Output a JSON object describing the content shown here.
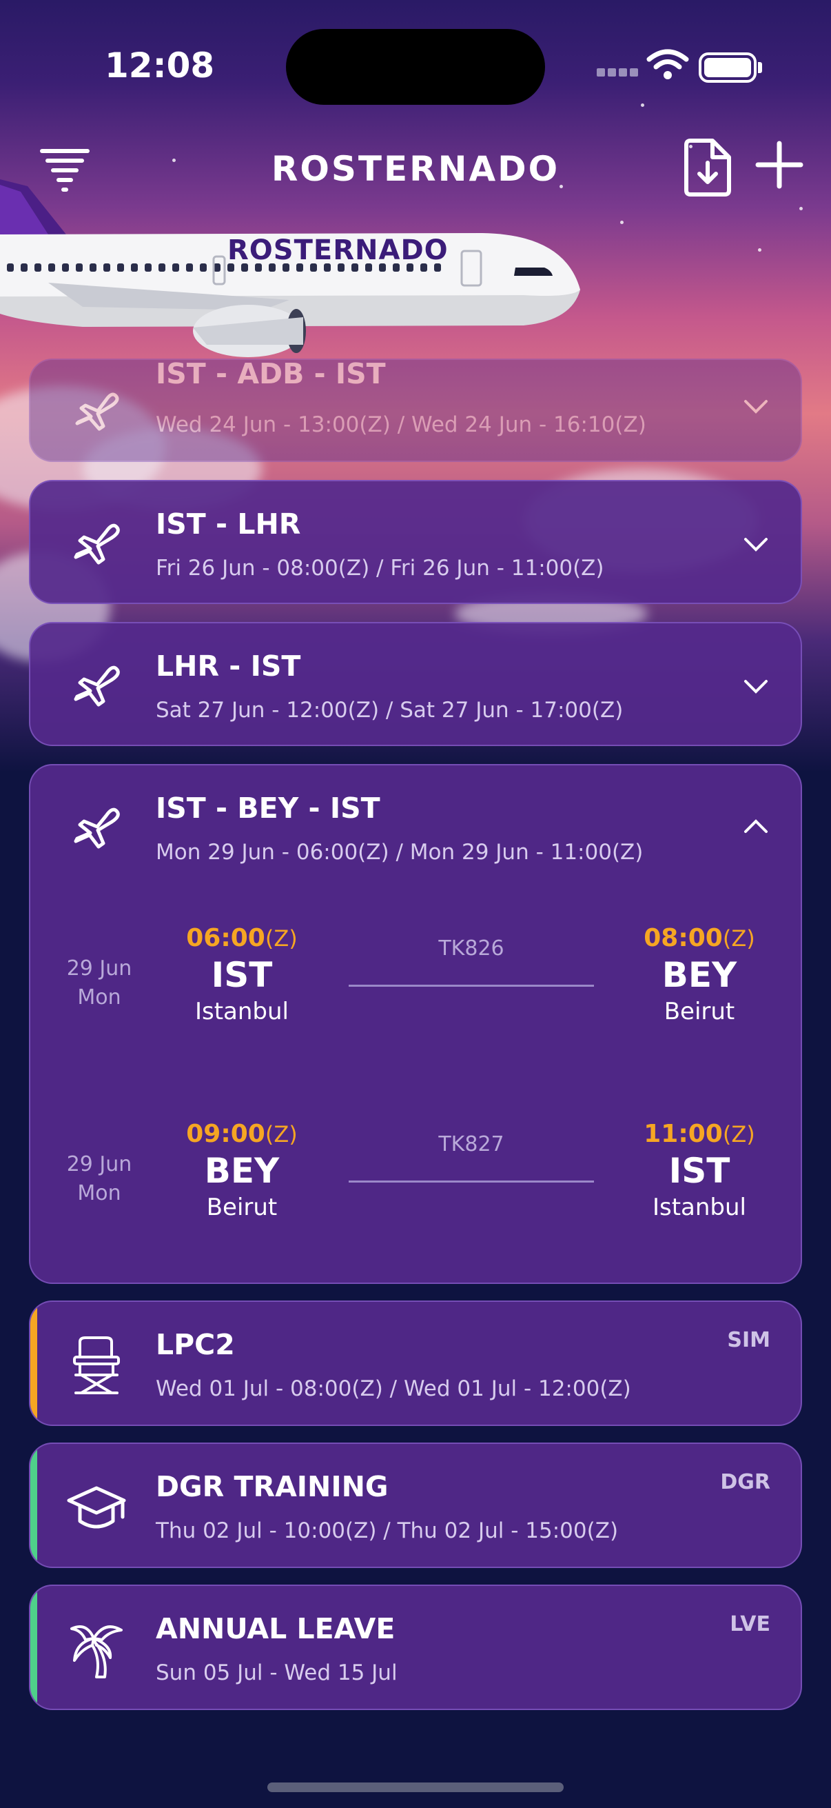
{
  "status_bar": {
    "time": "12:08"
  },
  "header": {
    "title": "ROSTERNADO"
  },
  "plane": {
    "brand": "ROSTERNADO"
  },
  "duties": [
    {
      "title": "IST - ADB - IST",
      "subtitle": "Wed 24 Jun - 13:00(Z) / Wed 24 Jun - 16:10(Z)",
      "icon": "plane-icon",
      "expanded": false
    },
    {
      "title": "IST - LHR",
      "subtitle": "Fri 26 Jun - 08:00(Z) / Fri 26 Jun - 11:00(Z)",
      "icon": "plane-icon",
      "expanded": false
    },
    {
      "title": "LHR - IST",
      "subtitle": "Sat 27 Jun - 12:00(Z) / Sat 27 Jun - 17:00(Z)",
      "icon": "plane-icon",
      "expanded": false
    },
    {
      "title": "IST - BEY - IST",
      "subtitle": "Mon 29 Jun - 06:00(Z) / Mon 29 Jun - 11:00(Z)",
      "icon": "plane-icon",
      "expanded": true,
      "legs": [
        {
          "date_day": "29 Jun",
          "date_weekday": "Mon",
          "dep_time": "06:00",
          "dep_zone": "(Z)",
          "dep_iata": "IST",
          "dep_city": "Istanbul",
          "flight": "TK826",
          "arr_time": "08:00",
          "arr_zone": "(Z)",
          "arr_iata": "BEY",
          "arr_city": "Beirut"
        },
        {
          "date_day": "29 Jun",
          "date_weekday": "Mon",
          "dep_time": "09:00",
          "dep_zone": "(Z)",
          "dep_iata": "BEY",
          "dep_city": "Beirut",
          "flight": "TK827",
          "arr_time": "11:00",
          "arr_zone": "(Z)",
          "arr_iata": "IST",
          "arr_city": "Istanbul"
        }
      ]
    },
    {
      "title": "LPC2",
      "subtitle": "Wed 01 Jul - 08:00(Z) / Wed 01 Jul - 12:00(Z)",
      "code": "SIM",
      "icon": "simulator-chair-icon",
      "accent": "#f6a623"
    },
    {
      "title": "DGR TRAINING",
      "subtitle": "Thu 02 Jul - 10:00(Z) / Thu 02 Jul - 15:00(Z)",
      "code": "DGR",
      "icon": "graduation-cap-icon",
      "accent": "#4fd08a"
    },
    {
      "title": "ANNUAL LEAVE",
      "subtitle": "Sun 05 Jul - Wed 15 Jul",
      "code": "LVE",
      "icon": "palm-tree-icon",
      "accent": "#4fd08a"
    }
  ],
  "colors": {
    "card_bg": "#55298c",
    "time_accent": "#f6a623",
    "page_bg": "#0e1340"
  }
}
